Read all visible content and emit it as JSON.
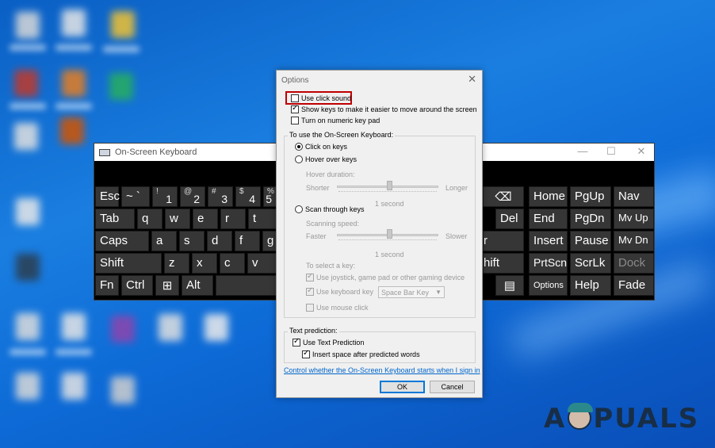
{
  "osk": {
    "title": "On-Screen Keyboard",
    "window_buttons": {
      "minimize": "—",
      "maximize": "☐",
      "close": "✕"
    },
    "rows": [
      [
        {
          "id": "esc",
          "label": "Esc"
        },
        {
          "id": "tilde",
          "label": "~ `"
        },
        {
          "id": "1",
          "sup": "!",
          "sub": "1"
        },
        {
          "id": "2",
          "sup": "@",
          "sub": "2"
        },
        {
          "id": "3",
          "sup": "#",
          "sub": "3"
        },
        {
          "id": "4",
          "sup": "$",
          "sub": "4"
        },
        {
          "id": "5",
          "sup": "%",
          "sub": "5"
        }
      ],
      [
        {
          "id": "tab",
          "label": "Tab"
        },
        {
          "id": "q",
          "label": "q"
        },
        {
          "id": "w",
          "label": "w"
        },
        {
          "id": "e",
          "label": "e"
        },
        {
          "id": "r",
          "label": "r"
        },
        {
          "id": "t",
          "label": "t"
        }
      ],
      [
        {
          "id": "caps",
          "label": "Caps"
        },
        {
          "id": "a",
          "label": "a"
        },
        {
          "id": "s",
          "label": "s"
        },
        {
          "id": "d",
          "label": "d"
        },
        {
          "id": "f",
          "label": "f"
        },
        {
          "id": "g",
          "label": "g"
        }
      ],
      [
        {
          "id": "shift-left",
          "label": "Shift"
        },
        {
          "id": "z",
          "label": "z"
        },
        {
          "id": "x",
          "label": "x"
        },
        {
          "id": "c",
          "label": "c"
        },
        {
          "id": "v",
          "label": "v"
        }
      ],
      [
        {
          "id": "fn",
          "label": "Fn"
        },
        {
          "id": "ctrl",
          "label": "Ctrl"
        },
        {
          "id": "win",
          "label": "⊞"
        },
        {
          "id": "alt",
          "label": "Alt"
        }
      ]
    ],
    "right_keys": {
      "backspace": "⌫",
      "del": "Del",
      "enter_partial": "r",
      "shift_right_partial": "hift",
      "menu_icon": "▤"
    },
    "nav_keys": [
      [
        "Home",
        "PgUp",
        "Nav"
      ],
      [
        "End",
        "PgDn",
        "Mv Up"
      ],
      [
        "Insert",
        "Pause",
        "Mv Dn"
      ],
      [
        "PrtScn",
        "ScrLk",
        "Dock"
      ],
      [
        "Options",
        "Help",
        "Fade"
      ]
    ]
  },
  "dialog": {
    "title": "Options",
    "close_glyph": "✕",
    "checkboxes": {
      "click_sound": {
        "label": "Use click sound",
        "checked": false
      },
      "show_keys": {
        "label": "Show keys to make it easier to move around the screen",
        "checked": true
      },
      "numeric_pad": {
        "label": "Turn on numeric key pad",
        "checked": false
      }
    },
    "use_group": {
      "label": "To use the On-Screen Keyboard:",
      "click_on_keys": "Click on keys",
      "hover_over_keys": "Hover over keys",
      "hover_duration": "Hover duration:",
      "hover_min": "Shorter",
      "hover_max": "Longer",
      "hover_value": "1 second",
      "scan_through_keys": "Scan through keys",
      "scanning_speed": "Scanning speed:",
      "scan_min": "Faster",
      "scan_max": "Slower",
      "scan_value": "1 second",
      "select_key": "To select a key:",
      "use_joystick": "Use joystick, game pad or other gaming device",
      "use_keyboard_key": "Use keyboard key",
      "keyboard_key_value": "Space Bar Key",
      "use_mouse_click": "Use mouse click"
    },
    "prediction_group": {
      "label": "Text prediction:",
      "use_text_prediction": "Use Text Prediction",
      "insert_space": "Insert space after predicted words"
    },
    "link": "Control whether the On-Screen Keyboard starts when I sign in",
    "ok": "OK",
    "cancel": "Cancel"
  },
  "watermark": {
    "left": "A",
    "right": "PUALS"
  },
  "colors": {
    "desktop": "#0d6ad6",
    "highlight_box": "#c00000",
    "link": "#0066cc"
  }
}
